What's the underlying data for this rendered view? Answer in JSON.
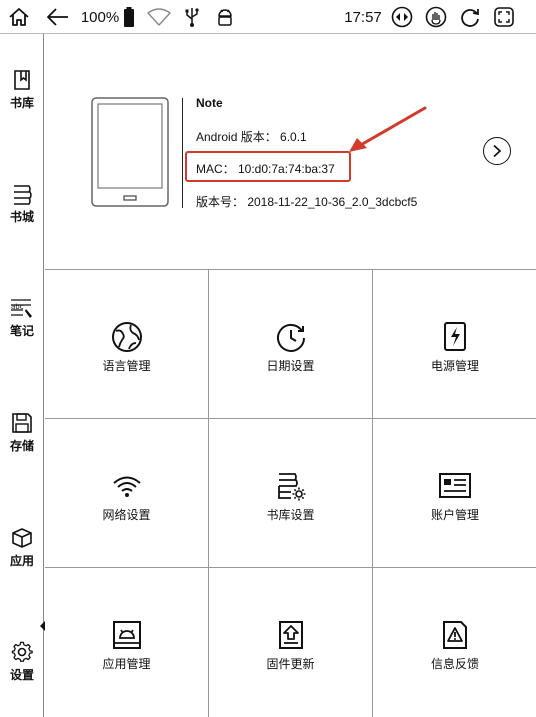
{
  "status_bar": {
    "battery_text": "100%",
    "time": "17:57",
    "icons": [
      "home-icon",
      "back-icon",
      "battery-icon",
      "wifi-icon",
      "usb-icon",
      "android-icon",
      "volume-toggle-icon",
      "touch-icon",
      "refresh-icon",
      "fullscreen-icon"
    ]
  },
  "sidebar": {
    "items": [
      {
        "label": "书库",
        "icon": "library-icon"
      },
      {
        "label": "书城",
        "icon": "bookstore-icon"
      },
      {
        "label": "笔记",
        "icon": "note-icon"
      },
      {
        "label": "存储",
        "icon": "storage-icon"
      },
      {
        "label": "应用",
        "icon": "apps-icon"
      },
      {
        "label": "设置",
        "icon": "settings-icon"
      }
    ],
    "active_index": 5
  },
  "device_info": {
    "name": "Note",
    "android_version": "Android 版本： 6.0.1",
    "mac": "MAC：  10:d0:7a:74:ba:37",
    "build_version": "版本号：  2018-11-22_10-36_2.0_3dcbcf5"
  },
  "colors": {
    "highlight": "#d23a2c",
    "text": "#111111",
    "divider": "#999999"
  },
  "settings": {
    "items": [
      {
        "label": "语言管理",
        "icon": "globe-icon"
      },
      {
        "label": "日期设置",
        "icon": "clock-icon"
      },
      {
        "label": "电源管理",
        "icon": "power-icon"
      },
      {
        "label": "网络设置",
        "icon": "wifi-settings-icon"
      },
      {
        "label": "书库设置",
        "icon": "library-settings-icon"
      },
      {
        "label": "账户管理",
        "icon": "account-icon"
      },
      {
        "label": "应用管理",
        "icon": "app-manage-icon"
      },
      {
        "label": "固件更新",
        "icon": "firmware-icon"
      },
      {
        "label": "信息反馈",
        "icon": "feedback-icon"
      }
    ]
  }
}
